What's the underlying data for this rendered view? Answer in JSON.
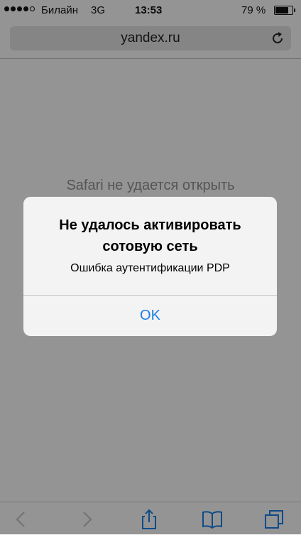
{
  "status_bar": {
    "carrier": "Билайн",
    "network": "3G",
    "time": "13:53",
    "battery_percent": "79 %",
    "battery_level": 0.79,
    "signal_bars_filled": 4,
    "signal_bars_total": 5
  },
  "url_bar": {
    "url": "yandex.ru",
    "reload_icon": "reload-icon"
  },
  "page": {
    "message": "Safari не удается открыть"
  },
  "alert": {
    "title": "Не удалось активировать сотовую сеть",
    "message": "Ошибка аутентификации PDP",
    "button_label": "OK"
  },
  "toolbar": {
    "icons": [
      "back-icon",
      "forward-icon",
      "share-icon",
      "bookmarks-icon",
      "tabs-icon"
    ]
  },
  "colors": {
    "accent": "#1a7ee5",
    "disabled": "#c7c7cc"
  }
}
